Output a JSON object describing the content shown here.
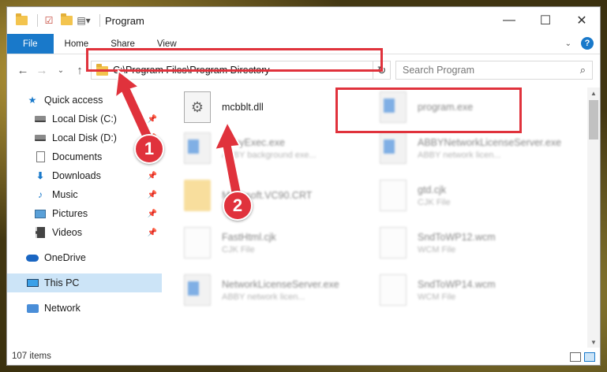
{
  "window": {
    "title": "Program",
    "controls": {
      "minimize": "—",
      "maximize": "☐",
      "close": "✕"
    }
  },
  "ribbon": {
    "tabs": [
      "File",
      "Home",
      "Share",
      "View"
    ],
    "help": "?"
  },
  "address": {
    "path": "C:\\Program Files\\Program Directory",
    "search_placeholder": "Search Program"
  },
  "sidebar": {
    "items": [
      {
        "label": "Quick access",
        "icon": "star-icon",
        "pinned": false
      },
      {
        "label": "Local Disk (C:)",
        "icon": "disk-icon",
        "pinned": true
      },
      {
        "label": "Local Disk (D:)",
        "icon": "disk-icon",
        "pinned": true
      },
      {
        "label": "Documents",
        "icon": "document-icon",
        "pinned": true
      },
      {
        "label": "Downloads",
        "icon": "download-icon",
        "pinned": true
      },
      {
        "label": "Music",
        "icon": "music-icon",
        "pinned": true
      },
      {
        "label": "Pictures",
        "icon": "picture-icon",
        "pinned": true
      },
      {
        "label": "Videos",
        "icon": "video-icon",
        "pinned": true
      },
      {
        "label": "OneDrive",
        "icon": "cloud-icon",
        "pinned": false
      },
      {
        "label": "This PC",
        "icon": "computer-icon",
        "pinned": false
      },
      {
        "label": "Network",
        "icon": "network-icon",
        "pinned": false
      }
    ]
  },
  "files": [
    {
      "name": "mcbblt.dll",
      "sub": "",
      "icon": "gear-file-icon",
      "highlighted": true
    },
    {
      "name": "program.exe",
      "sub": "",
      "icon": "exe-icon"
    },
    {
      "name": "AbbyExec.exe",
      "sub": "ABBY background exe...",
      "icon": "exe-icon"
    },
    {
      "name": "ABBYNetworkLicenseServer.exe",
      "sub": "ABBY network licen...",
      "icon": "exe-icon"
    },
    {
      "name": "Microsoft.VC90.CRT",
      "sub": "",
      "icon": "folder-icon"
    },
    {
      "name": "gtd.cjk",
      "sub": "CJK File",
      "icon": "document-icon"
    },
    {
      "name": "FastHtml.cjk",
      "sub": "CJK File",
      "icon": "document-icon"
    },
    {
      "name": "SndToWP12.wcm",
      "sub": "WCM File",
      "icon": "document-icon"
    },
    {
      "name": "NetworkLicenseServer.exe",
      "sub": "ABBY network licen...",
      "icon": "exe-icon"
    },
    {
      "name": "SndToWP14.wcm",
      "sub": "WCM File",
      "icon": "document-icon"
    }
  ],
  "status": {
    "item_count": "107 items"
  },
  "callouts": [
    "1",
    "2"
  ],
  "colors": {
    "accent": "#1979ca",
    "highlight": "#e0323c",
    "selected": "#cce4f7"
  }
}
